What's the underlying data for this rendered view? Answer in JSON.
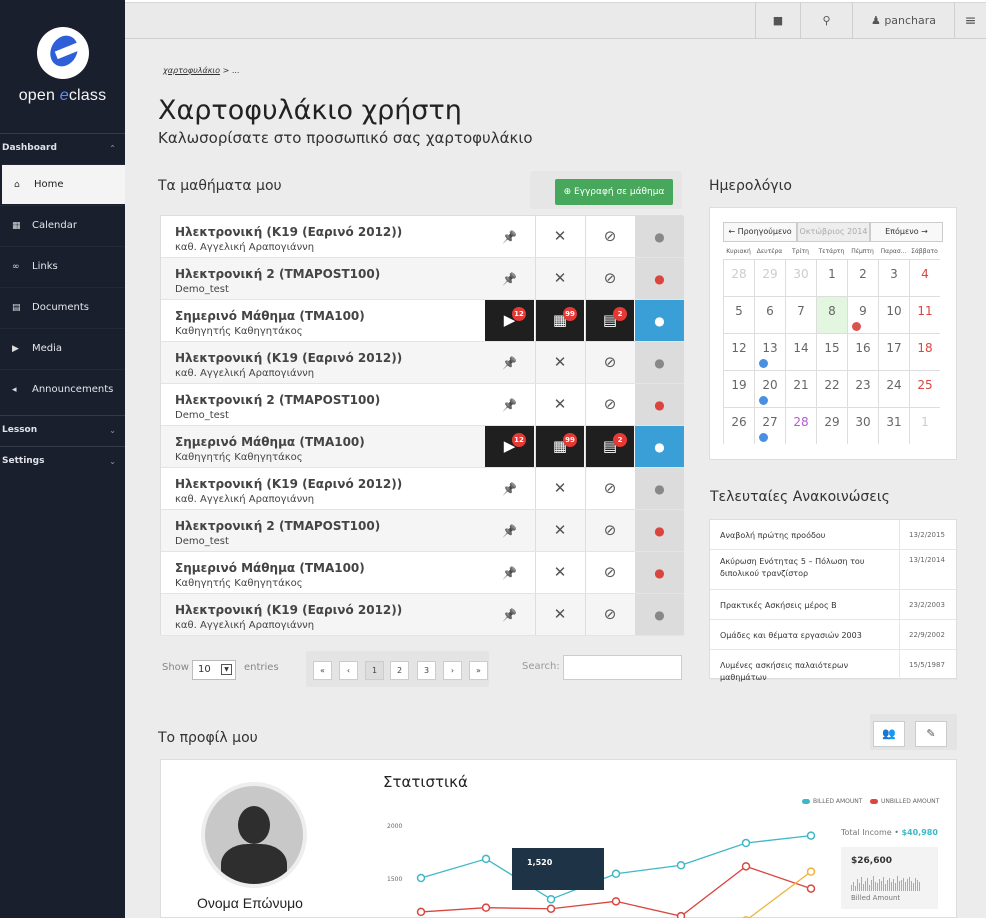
{
  "logo": {
    "text_prefix": "open ",
    "text_accent": "e",
    "text_suffix": "class"
  },
  "sidebar": {
    "section_dashboard": "Dashboard",
    "items": [
      {
        "label": "Home",
        "icon": "home-icon"
      },
      {
        "label": "Calendar",
        "icon": "calendar-icon"
      },
      {
        "label": "Links",
        "icon": "link-icon"
      },
      {
        "label": "Documents",
        "icon": "document-icon"
      },
      {
        "label": "Media",
        "icon": "play-icon"
      },
      {
        "label": "Announcements",
        "icon": "megaphone-icon"
      }
    ],
    "section_lesson": "Lesson",
    "section_settings": "Settings"
  },
  "topbar": {
    "username": "panchara"
  },
  "breadcrumb": {
    "link": "χαρτοφυλάκιο",
    "current": "..."
  },
  "page": {
    "title": "Χαρτοφυλάκιο χρήστη",
    "subtitle": "Καλωσορίσατε στο προσωπικό σας χαρτοφυλάκιο"
  },
  "courses": {
    "heading": "Τα μαθήματα μου",
    "enroll_label": "Εγγραφή σε μάθημα",
    "rows": [
      {
        "name": "Ηλεκτρονική (Κ19 (Εαρινό 2012))",
        "prof": "καθ. Αγγελική Αραπογιάννη"
      },
      {
        "name": "Ηλεκτρονική 2 (TMAPOST100)",
        "prof": "Demo_test"
      },
      {
        "name": "Σημερινό Μάθημα (ΤΜΑ100)",
        "prof": "Καθηγητής Καθηγητάκος"
      },
      {
        "name": "Ηλεκτρονική (Κ19 (Εαρινό 2012))",
        "prof": "καθ. Αγγελική Αραπογιάννη"
      },
      {
        "name": "Ηλεκτρονική 2 (TMAPOST100)",
        "prof": "Demo_test"
      },
      {
        "name": "Σημερινό Μάθημα (ΤΜΑ100)",
        "prof": "Καθηγητής Καθηγητάκος"
      },
      {
        "name": "Ηλεκτρονική (Κ19 (Εαρινό 2012))",
        "prof": "καθ. Αγγελική Αραπογιάννη"
      },
      {
        "name": "Ηλεκτρονική 2 (TMAPOST100)",
        "prof": "Demo_test"
      },
      {
        "name": "Σημερινό Μάθημα (ΤΜΑ100)",
        "prof": "Καθηγητής Καθηγητάκος"
      },
      {
        "name": "Ηλεκτρονική (Κ19 (Εαρινό 2012))",
        "prof": "καθ. Αγγελική Αραπογιάννη"
      }
    ],
    "badges": {
      "media": "12",
      "calendar": "99",
      "docs": "2"
    },
    "show_label": "Show",
    "entries_value": "10",
    "entries_label": "entries",
    "pager": [
      "«",
      "‹",
      "1",
      "2",
      "3",
      "›",
      "»"
    ],
    "search_label": "Search:"
  },
  "calendar": {
    "heading": "Ημερολόγιο",
    "prev": "← Προηγούμενο",
    "month": "Οκτώβριος 2014",
    "next": "Επόμενο →",
    "dow": [
      "Κυριακή",
      "Δευτέρα",
      "Τρίτη",
      "Τετάρτη",
      "Πέμπτη",
      "Παρασ...",
      "Σάββατο"
    ],
    "weeks": [
      [
        "28",
        "29",
        "30",
        "1",
        "2",
        "3",
        "4"
      ],
      [
        "5",
        "6",
        "7",
        "8",
        "9",
        "10",
        "11"
      ],
      [
        "12",
        "13",
        "14",
        "15",
        "16",
        "17",
        "18"
      ],
      [
        "19",
        "20",
        "21",
        "22",
        "23",
        "24",
        "25"
      ],
      [
        "26",
        "27",
        "28",
        "29",
        "30",
        "31",
        "1"
      ]
    ]
  },
  "announcements": {
    "heading": "Τελευταίες Ανακοινώσεις",
    "items": [
      {
        "title": "Αναβολή πρώτης προόδου",
        "date": "13/2/2015"
      },
      {
        "title": "Ακύρωση Ενότητας 5 – Πόλωση του διπολικού τρανζίστορ",
        "date": "13/1/2014"
      },
      {
        "title": "Πρακτικές Ασκήσεις μέρος Β",
        "date": "23/2/2003"
      },
      {
        "title": "Ομάδες και θέματα εργασιών 2003",
        "date": "22/9/2002"
      },
      {
        "title": "Λυμένες ασκήσεις παλαιότερων μαθημάτων",
        "date": "15/5/1987"
      }
    ]
  },
  "profile": {
    "heading": "Το προφίλ μου",
    "name": "Ονομα Επώνυμο",
    "stats_title": "Στατιστικά",
    "total_label": "Total Income • ",
    "total_value": "$40,980",
    "billed_value": "$26,600",
    "billed_label": "Billed Amount",
    "tooltip": "1,520"
  },
  "chart_data": {
    "type": "line",
    "ytick_labels": [
      "2000",
      "1500"
    ],
    "series": [
      {
        "name": "BILLED AMOUNT",
        "color": "#3fb8c6",
        "values": [
          1500,
          1680,
          1300,
          1540,
          1620,
          1830,
          1900
        ]
      },
      {
        "name": "UNBILLED AMOUNT",
        "color": "#d9463f",
        "values": [
          1180,
          1220,
          1210,
          1280,
          1140,
          1610,
          1400
        ]
      },
      {
        "name": "",
        "color": "#f0b43c",
        "values": [
          null,
          null,
          null,
          null,
          null,
          1100,
          1560
        ]
      }
    ],
    "colors": {
      "billed": "#3fb8c6",
      "unbilled": "#d9463f"
    }
  }
}
